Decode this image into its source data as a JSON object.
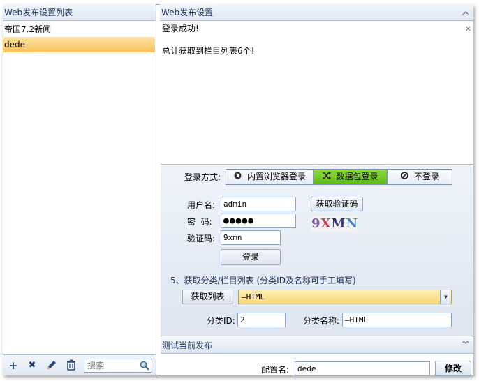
{
  "left_panel": {
    "title": "Web发布设置列表",
    "items": [
      {
        "label": "帝国7.2新闻",
        "selected": false
      },
      {
        "label": "dede",
        "selected": true
      }
    ],
    "toolbar": {
      "add_icon": "+",
      "delete_icon": "✖",
      "edit_icon": "pencil-icon",
      "trash_icon": "trash-icon",
      "search_placeholder": "搜索"
    }
  },
  "right_panel": {
    "title": "Web发布设置",
    "log": [
      "登录成功!",
      "",
      "总计获取到栏目列表6个!"
    ],
    "login": {
      "method_label": "登录方式:",
      "methods": [
        {
          "label": "内置浏览器登录",
          "icon": "globe-icon",
          "active": false
        },
        {
          "label": "数据包登录",
          "icon": "shuffle-icon",
          "active": true
        },
        {
          "label": "不登录",
          "icon": "block-icon",
          "active": false
        }
      ],
      "username_label": "用户名:",
      "username_value": "admin",
      "password_label": "密  码:",
      "password_value": "●●●●●",
      "captcha_label": "验证码:",
      "captcha_value": "9xmn",
      "captcha_button": "获取验证码",
      "captcha_image_text": [
        "9",
        "X",
        "M",
        "N"
      ],
      "login_button": "登录"
    },
    "categories": {
      "section_title": "5、获取分类/栏目列表  (分类ID及名称可手工填写)",
      "fetch_button": "获取列表",
      "selected": "—HTML",
      "id_label": "分类ID:",
      "id_value": "2",
      "name_label": "分类名称:",
      "name_value": "—HTML"
    },
    "test_section_title": "测试当前发布",
    "config_label": "配置名:",
    "config_value": "dede",
    "modify_button": "修改"
  },
  "colors": {
    "selected_item": "#f8c35a",
    "active_segment": "#6cc322",
    "header_text": "#1c2f5a"
  }
}
